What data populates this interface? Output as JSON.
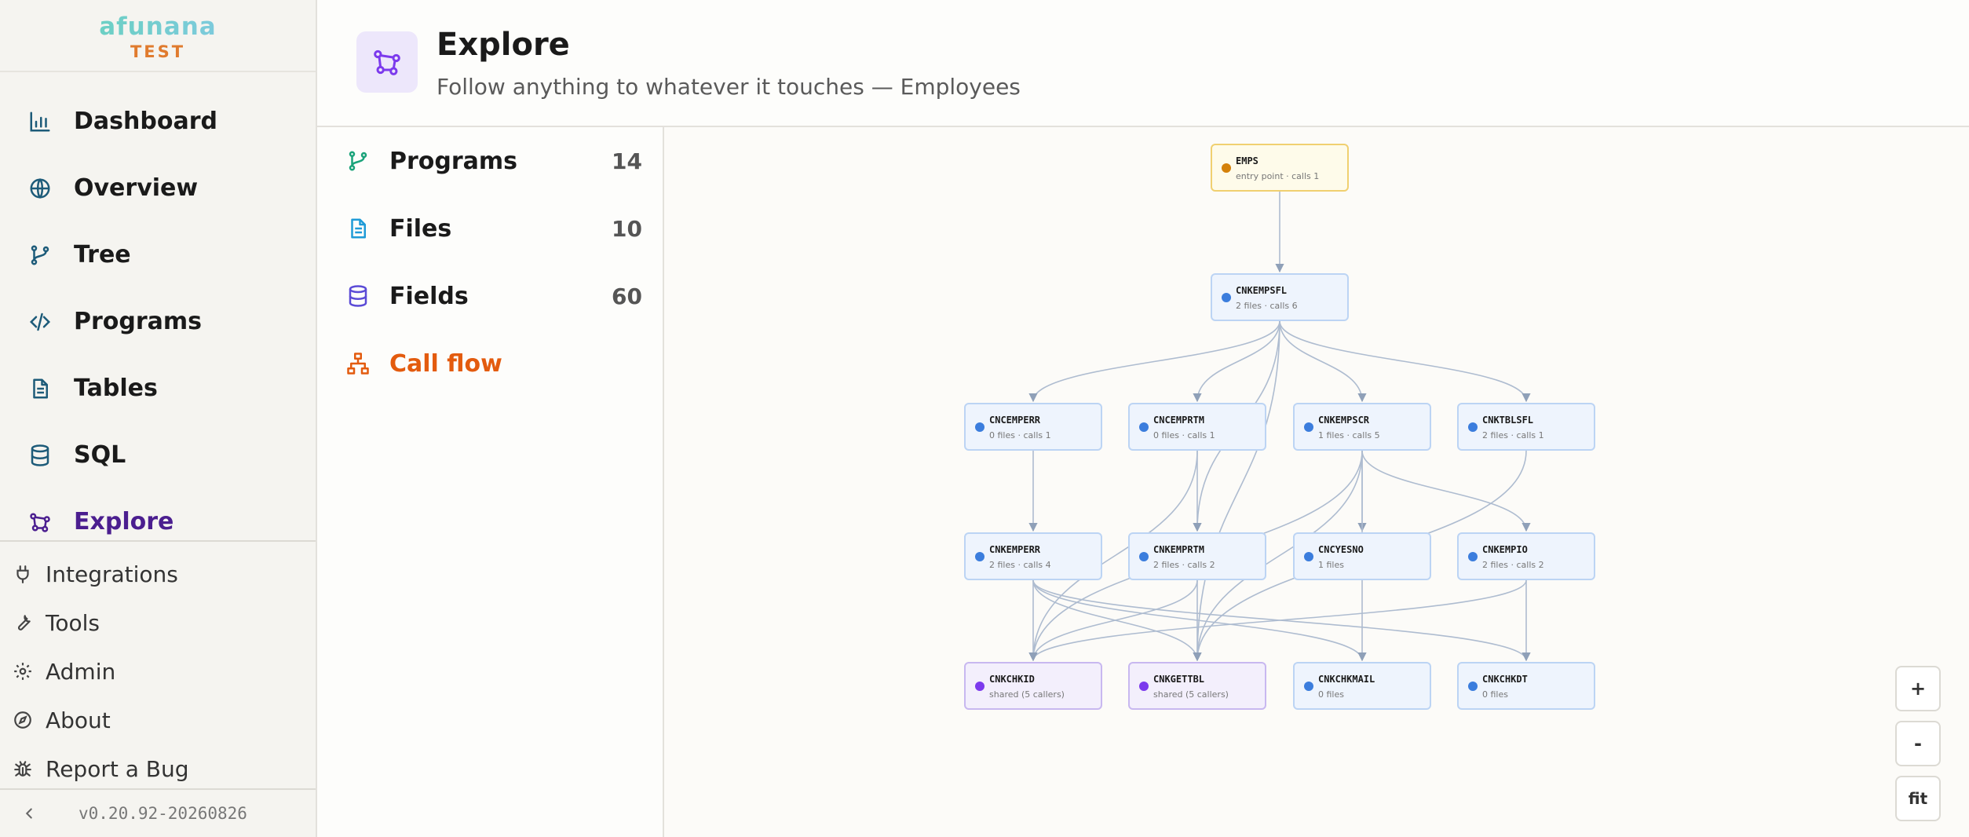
{
  "brand": {
    "name": "afunana",
    "env": "TEST"
  },
  "nav": {
    "primary": [
      {
        "label": "Dashboard",
        "icon": "bar-chart-icon"
      },
      {
        "label": "Overview",
        "icon": "globe-icon"
      },
      {
        "label": "Tree",
        "icon": "git-branch-icon"
      },
      {
        "label": "Programs",
        "icon": "code-icon"
      },
      {
        "label": "Tables",
        "icon": "document-icon"
      },
      {
        "label": "SQL",
        "icon": "database-icon"
      },
      {
        "label": "Explore",
        "icon": "graph-nodes-icon",
        "active": true
      }
    ],
    "secondary": [
      {
        "label": "Integrations",
        "icon": "plug-icon"
      },
      {
        "label": "Tools",
        "icon": "wrench-icon"
      },
      {
        "label": "Admin",
        "icon": "gear-icon"
      },
      {
        "label": "About",
        "icon": "compass-icon"
      },
      {
        "label": "Report a Bug",
        "icon": "bug-icon"
      }
    ]
  },
  "footer": {
    "version": "v0.20.92-20260826"
  },
  "header": {
    "title": "Explore",
    "subtitle": "Follow anything to whatever it touches — Employees"
  },
  "facets": [
    {
      "label": "Programs",
      "count": "14",
      "icon": "git-branch-icon",
      "color": "#1aa37a"
    },
    {
      "label": "Files",
      "count": "10",
      "icon": "file-icon",
      "color": "#1e9bd7"
    },
    {
      "label": "Fields",
      "count": "60",
      "icon": "database-icon",
      "color": "#5b4bd6"
    },
    {
      "label": "Call flow",
      "count": "",
      "icon": "hierarchy-icon",
      "color": "#e35b0e",
      "active": true
    }
  ],
  "graph": {
    "nodes": [
      {
        "id": "EMPS",
        "meta": "entry point · calls 1",
        "kind": "entry"
      },
      {
        "id": "CNKEMPSFL",
        "meta": "2 files · calls 6",
        "kind": "program"
      },
      {
        "id": "CNCEMPERR",
        "meta": "0 files · calls 1",
        "kind": "program"
      },
      {
        "id": "CNCEMPRTM",
        "meta": "0 files · calls 1",
        "kind": "program"
      },
      {
        "id": "CNKEMPSCR",
        "meta": "1 files · calls 5",
        "kind": "program"
      },
      {
        "id": "CNKTBLSFL",
        "meta": "2 files · calls 1",
        "kind": "program"
      },
      {
        "id": "CNKEMPERR",
        "meta": "2 files · calls 4",
        "kind": "program"
      },
      {
        "id": "CNKEMPRTM",
        "meta": "2 files · calls 2",
        "kind": "program"
      },
      {
        "id": "CNCYESNO",
        "meta": "1 files",
        "kind": "program"
      },
      {
        "id": "CNKEMPIO",
        "meta": "2 files · calls 2",
        "kind": "program"
      },
      {
        "id": "CNKCHKID",
        "meta": "shared (5 callers)",
        "kind": "shared"
      },
      {
        "id": "CNKGETTBL",
        "meta": "shared (5 callers)",
        "kind": "shared"
      },
      {
        "id": "CNKCHKMAIL",
        "meta": "0 files",
        "kind": "program"
      },
      {
        "id": "CNKCHKDT",
        "meta": "0 files",
        "kind": "program"
      }
    ],
    "edges": [
      [
        "EMPS",
        "CNKEMPSFL"
      ],
      [
        "CNKEMPSFL",
        "CNCEMPERR"
      ],
      [
        "CNKEMPSFL",
        "CNCEMPRTM"
      ],
      [
        "CNKEMPSFL",
        "CNKEMPSCR"
      ],
      [
        "CNKEMPSFL",
        "CNKTBLSFL"
      ],
      [
        "CNKEMPSFL",
        "CNKEMPRTM"
      ],
      [
        "CNKEMPSFL",
        "CNKGETTBL"
      ],
      [
        "CNCEMPERR",
        "CNKEMPERR"
      ],
      [
        "CNCEMPRTM",
        "CNKEMPRTM"
      ],
      [
        "CNCEMPRTM",
        "CNKCHKID"
      ],
      [
        "CNKEMPSCR",
        "CNCYESNO"
      ],
      [
        "CNKEMPSCR",
        "CNKEMPIO"
      ],
      [
        "CNKEMPSCR",
        "CNKCHKID"
      ],
      [
        "CNKEMPSCR",
        "CNKGETTBL"
      ],
      [
        "CNKEMPSCR",
        "CNKCHKMAIL"
      ],
      [
        "CNKTBLSFL",
        "CNKGETTBL"
      ],
      [
        "CNKEMPERR",
        "CNKCHKID"
      ],
      [
        "CNKEMPERR",
        "CNKGETTBL"
      ],
      [
        "CNKEMPERR",
        "CNKCHKMAIL"
      ],
      [
        "CNKEMPERR",
        "CNKCHKDT"
      ],
      [
        "CNKEMPRTM",
        "CNKCHKID"
      ],
      [
        "CNKEMPRTM",
        "CNKGETTBL"
      ],
      [
        "CNKEMPIO",
        "CNKCHKID"
      ],
      [
        "CNKEMPIO",
        "CNKCHKDT"
      ]
    ]
  },
  "zoom": {
    "in": "+",
    "out": "-",
    "fit": "fit"
  }
}
